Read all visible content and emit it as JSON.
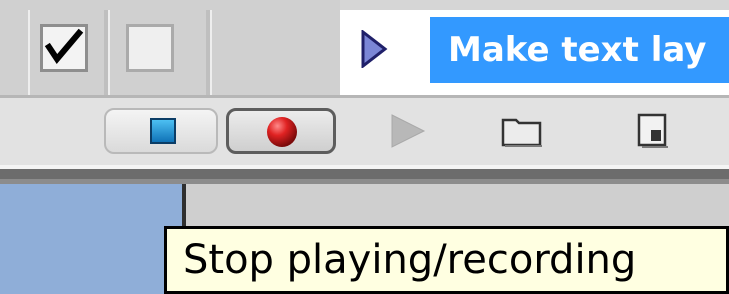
{
  "actions_panel": {
    "selected_action": {
      "label": "Make text lay",
      "highlight_color": "#3399ff"
    },
    "toggle_item_checkbox": {
      "checked": true,
      "icon": "checkmark-icon"
    },
    "toggle_dialog_checkbox": {
      "checked": false
    },
    "expand_icon": "triangle-right-icon"
  },
  "toolbar": {
    "buttons": [
      {
        "name": "stop",
        "icon": "stop-square-icon",
        "color": "#1e8fd6"
      },
      {
        "name": "record",
        "icon": "record-dot-icon",
        "color": "#d62020"
      },
      {
        "name": "play",
        "icon": "play-triangle-icon",
        "enabled": false
      },
      {
        "name": "new-set",
        "icon": "folder-icon"
      },
      {
        "name": "new-action",
        "icon": "new-action-icon"
      }
    ]
  },
  "tooltip": {
    "text": "Stop playing/recording"
  }
}
